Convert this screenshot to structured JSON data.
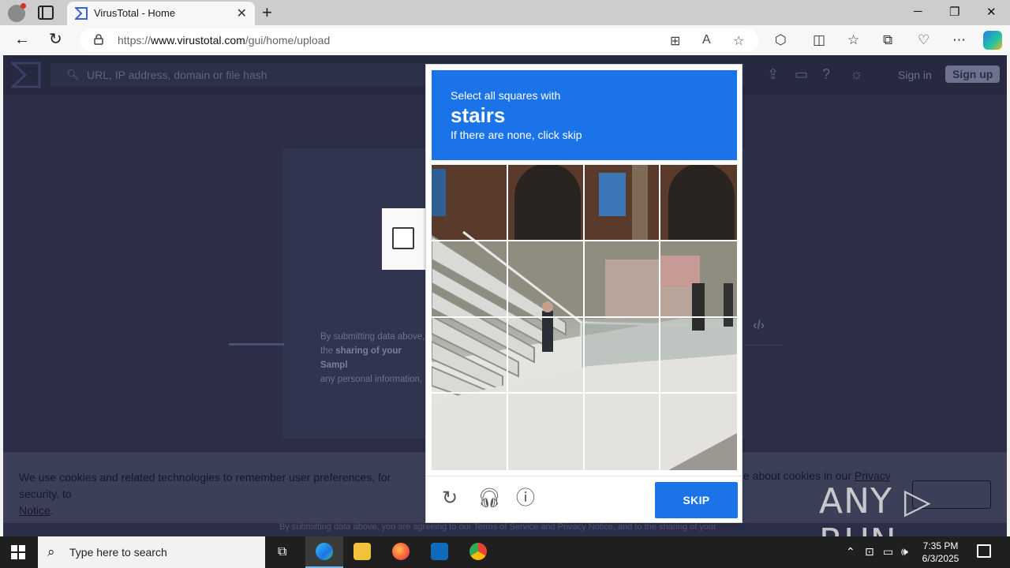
{
  "browser": {
    "tab_title": "VirusTotal - Home",
    "tab_close": "✕",
    "new_tab": "+",
    "url_prefix": "https://",
    "url_domain": "www.virustotal.com",
    "url_path": "/gui/home/upload",
    "window_minimize": "─",
    "window_restore": "❐",
    "window_close": "✕"
  },
  "virustotal": {
    "search_placeholder": "URL, IP address, domain or file hash",
    "sign_in": "Sign in",
    "sign_up": "Sign up",
    "desc_line1": "By submitting data above,",
    "desc_line2_prefix": "the ",
    "desc_line2_bold": "sharing of your Sampl",
    "desc_line3": "any personal information,",
    "cookie_text_prefix": "We use cookies and related technologies to remember user preferences, for security, to",
    "cookie_link_privacy_notice": "Notice",
    "cookie_text_right": "e about cookies in our",
    "cookie_link_privacy": "Privacy",
    "footer_strip": "By submitting data above, you are agreeing to our Terms of Service and Privacy Notice, and to the sharing of your"
  },
  "captcha": {
    "instruction": "Select all squares with",
    "target_word": "stairs",
    "hint": "If there are none, click skip",
    "skip_label": "SKIP",
    "grid_rows": 4,
    "grid_cols": 4
  },
  "watermark": "ANY ▷ RUN",
  "taskbar": {
    "search_placeholder": "Type here to search",
    "time": "7:35 PM",
    "date": "6/3/2025"
  },
  "colors": {
    "captcha_blue": "#1a73e8",
    "vt_bg": "#2b2e46"
  }
}
